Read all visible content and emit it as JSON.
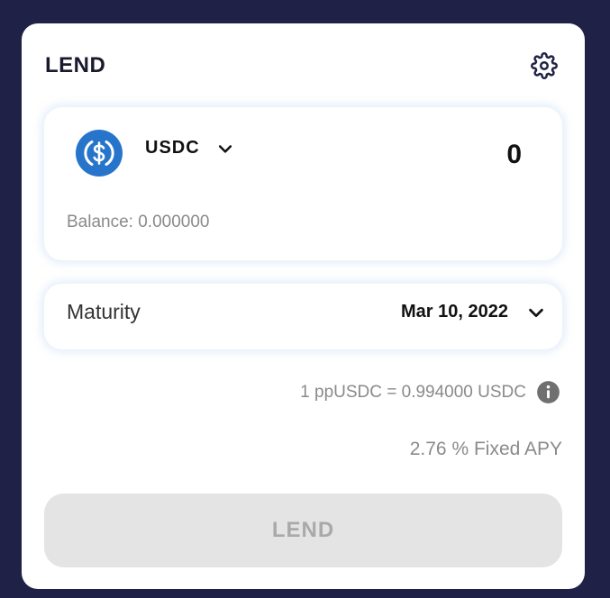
{
  "header": {
    "title": "LEND",
    "settings_icon": "gear-icon"
  },
  "asset": {
    "coin_icon": "usdc-coin-icon",
    "token": "USDC",
    "amount": "0",
    "balance_label": "Balance: 0.000000"
  },
  "maturity": {
    "label": "Maturity",
    "selected": "Mar 10, 2022"
  },
  "rate": {
    "text": "1 ppUSDC = 0.994000 USDC",
    "info_icon": "info-icon"
  },
  "apy": {
    "text": "2.76 % Fixed APY"
  },
  "action": {
    "button_label": "LEND",
    "disabled": true
  },
  "colors": {
    "background": "#1f2147",
    "card": "#ffffff",
    "usdc_blue": "#2775ca",
    "muted_text": "#8a8a8a",
    "button_disabled_bg": "#e4e4e4",
    "button_disabled_text": "#a9a9a9"
  }
}
